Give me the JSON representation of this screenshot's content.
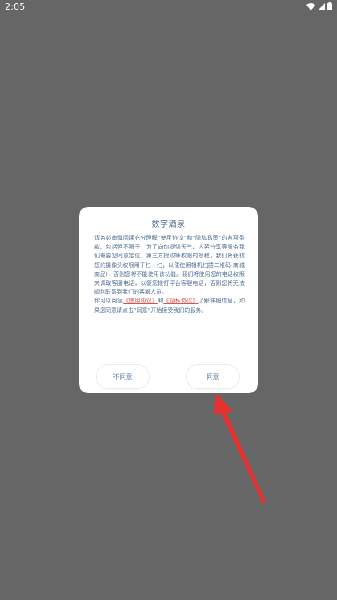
{
  "status_bar": {
    "time": "2:05",
    "icons": [
      "wifi-icon",
      "signal-icon",
      "battery-icon"
    ]
  },
  "dialog": {
    "title": "数字酒泉",
    "paragraph1": "请务必审慎阅读充分理解“使用协议”和“隐私政策”的各项条款。包括但不限于：为了向你提供天气、内容分享等服务我们需要您同意定位，第三方授权等权限的授权，我们将获取您的摄像头权限用于扫一扫，以便使用相机扫描二维码(商城商品)，否则您将不能使用该功能。我们将使用您的电话权限来调取客服电话，以便您拨打平台客服电话，否则您将无法顺利联系到我们的客服人员。",
    "paragraph2_prefix": "你可以阅读",
    "link_terms": "《使用协议》",
    "paragraph2_and": "和",
    "link_privacy": "《隐私协议》",
    "paragraph2_suffix": "了解详细信息，如果您同意请点击“同意”开始接受我们的服务。",
    "disagree_label": "不同意",
    "agree_label": "同意"
  },
  "colors": {
    "overlay": "#666666",
    "dialog_text": "#4d6f93",
    "link": "#d9534f",
    "arrow": "#e8302f"
  }
}
